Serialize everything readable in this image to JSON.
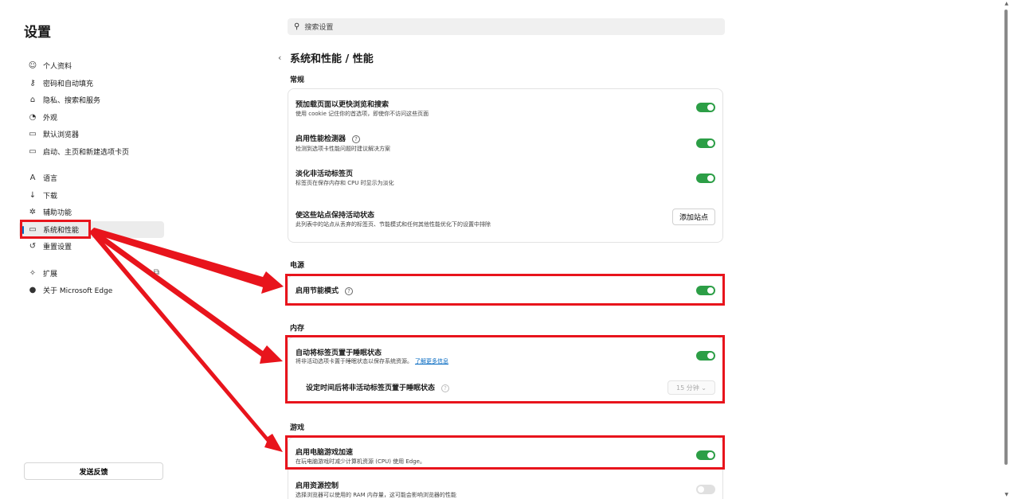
{
  "app": {
    "title": "设置"
  },
  "sidebar": {
    "items": [
      {
        "label": "个人资料",
        "icon": "profile-icon"
      },
      {
        "label": "密码和自动填充",
        "icon": "key-icon"
      },
      {
        "label": "隐私、搜索和服务",
        "icon": "lock-icon"
      },
      {
        "label": "外观",
        "icon": "appearance-icon"
      },
      {
        "label": "默认浏览器",
        "icon": "browser-icon"
      },
      {
        "label": "启动、主页和新建选项卡页",
        "icon": "home-icon"
      },
      {
        "label": "语言",
        "icon": "language-icon"
      },
      {
        "label": "下载",
        "icon": "download-icon"
      },
      {
        "label": "辅助功能",
        "icon": "accessibility-icon"
      },
      {
        "label": "系统和性能",
        "icon": "laptop-icon",
        "active": true
      },
      {
        "label": "重置设置",
        "icon": "reset-icon"
      },
      {
        "label": "扩展",
        "icon": "puzzle-icon"
      },
      {
        "label": "关于 Microsoft Edge",
        "icon": "edge-logo-icon"
      }
    ],
    "feedback_label": "发送反馈"
  },
  "search": {
    "placeholder": "搜索设置"
  },
  "main": {
    "title": "系统和性能 / 性能",
    "sections": {
      "general": {
        "title": "常规",
        "rows": [
          {
            "title": "预加载页面以更快浏览和搜索",
            "desc": "使用 cookie 记住你的首选项，即使你不访问这些页面",
            "toggle": "on"
          },
          {
            "title": "启用性能检测器",
            "desc": "检测到选项卡性能问题时建议解决方案",
            "toggle": "on",
            "help": "?"
          },
          {
            "title": "淡化非活动标签页",
            "desc": "标签页在保存内存和 CPU 时显示为淡化",
            "toggle": "on"
          },
          {
            "title": "使这些站点保持活动状态",
            "desc": "此列表中的站点从丢弃的标签页、节能模式和任何其他性能优化下的设置中排除",
            "button": "添加站点"
          }
        ]
      },
      "power": {
        "title": "电源",
        "rows": [
          {
            "title": "启用节能模式",
            "toggle": "on",
            "help": "?"
          }
        ]
      },
      "memory": {
        "title": "内存",
        "rows": [
          {
            "title": "自动将标签页置于睡眠状态",
            "desc": "将非活动选项卡置于睡眠状态以保存系统资源。",
            "link": "了解更多信息",
            "toggle": "on"
          },
          {
            "title": "设定时间后将非活动标签页置于睡眠状态",
            "help": "?",
            "select": "15 分钟 ⌄"
          }
        ]
      },
      "gaming": {
        "title": "游戏",
        "rows": [
          {
            "title": "启用电脑游戏加速",
            "desc": "在玩电脑游戏时减少计算机资源 (CPU) 使用 Edge。",
            "toggle": "on"
          },
          {
            "title": "启用资源控制",
            "desc": "选择浏览器可以使用的 RAM 内存量，这可能会影响浏览器的性能",
            "toggle": "off"
          }
        ]
      }
    }
  },
  "colors": {
    "accent": "#0067c0",
    "toggle_on": "#2c9e46",
    "annotation": "#e8141c"
  }
}
